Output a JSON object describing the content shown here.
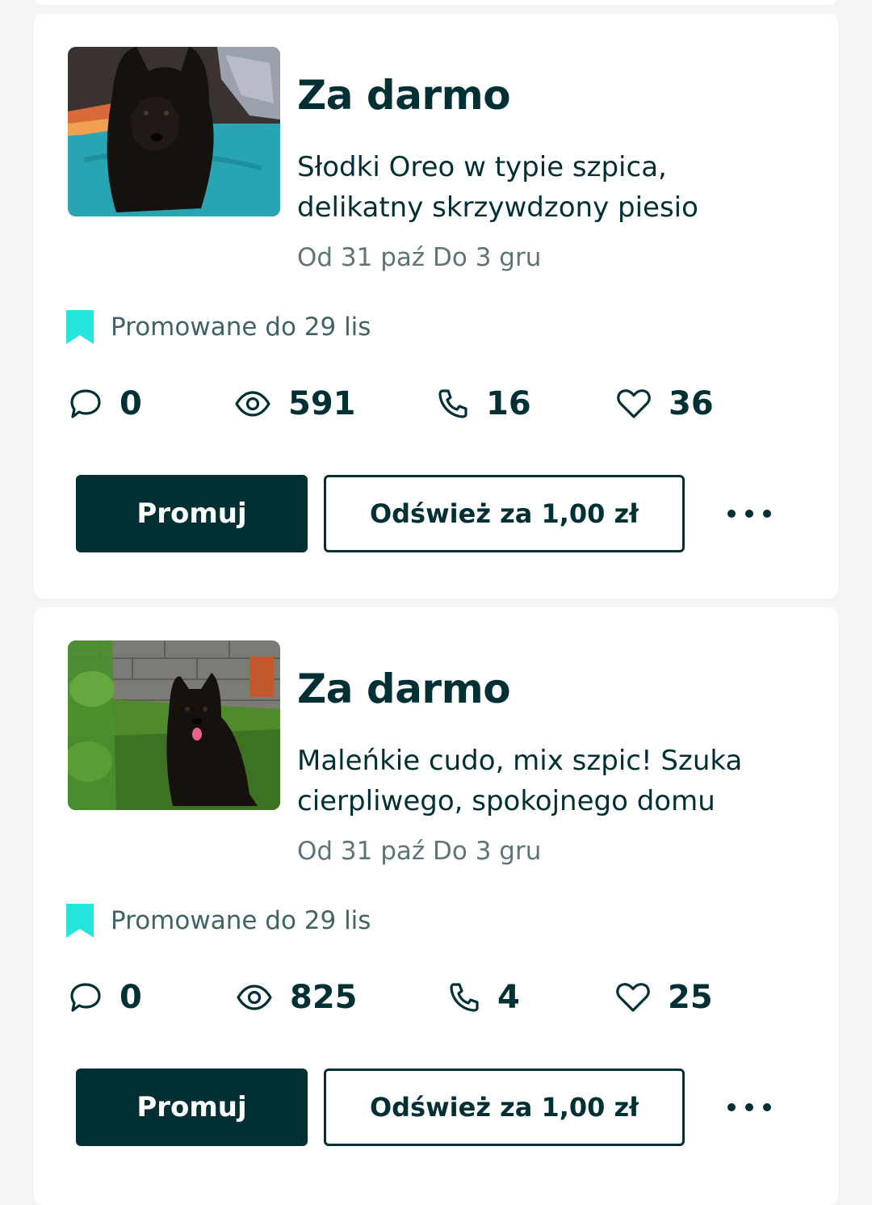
{
  "colors": {
    "primary": "#002f34",
    "accent": "#23e5db",
    "muted": "#5e7478",
    "background": "#f2f4f5",
    "card": "#ffffff"
  },
  "listings": [
    {
      "price": "Za darmo",
      "description": "Słodki Oreo w typie szpica, delikatny skrzywdzony piesio",
      "dates": "Od 31 paź Do 3 gru",
      "promo_text": "Promowane do 29 lis",
      "stats": {
        "messages": "0",
        "views": "591",
        "calls": "16",
        "favorites": "36"
      },
      "promote_label": "Promuj",
      "refresh_label": "Odśwież za 1,00 zł",
      "icons": {
        "bookmark": "bookmark-icon",
        "messages": "chat-bubble-icon",
        "views": "eye-icon",
        "calls": "phone-icon",
        "favorites": "heart-icon",
        "more": "more-dots-icon"
      }
    },
    {
      "price": "Za darmo",
      "description": "Maleńkie cudo, mix szpic! Szuka cierpliwego, spokojnego domu",
      "dates": "Od 31 paź Do 3 gru",
      "promo_text": "Promowane do 29 lis",
      "stats": {
        "messages": "0",
        "views": "825",
        "calls": "4",
        "favorites": "25"
      },
      "promote_label": "Promuj",
      "refresh_label": "Odśwież za 1,00 zł",
      "icons": {
        "bookmark": "bookmark-icon",
        "messages": "chat-bubble-icon",
        "views": "eye-icon",
        "calls": "phone-icon",
        "favorites": "heart-icon",
        "more": "more-dots-icon"
      }
    }
  ]
}
